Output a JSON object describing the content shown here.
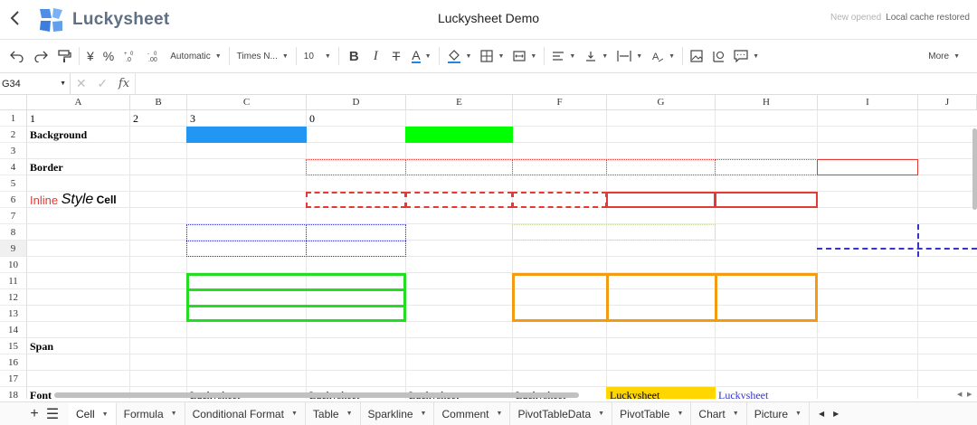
{
  "header": {
    "back_icon": "chevron-left-icon",
    "logo_text": "Luckysheet",
    "title": "Luckysheet Demo",
    "status_opened": "New opened",
    "status_restored": "Local cache restored"
  },
  "toolbar": {
    "undo_icon": "undo-icon",
    "redo_icon": "redo-icon",
    "format_painter_icon": "paint-roller-icon",
    "currency": "¥",
    "percent": "%",
    "dec_decrease": ".0←",
    "dec_increase": ".00→",
    "number_format": "Automatic",
    "font_family": "Times N...",
    "font_size": "10",
    "bold": "B",
    "italic": "I",
    "strikethrough": "T",
    "text_color": "A",
    "text_color_value": "#1e88e5",
    "fill_icon": "paint-bucket-icon",
    "more": "More"
  },
  "formula_bar": {
    "cell_ref": "G34",
    "fx": "fx"
  },
  "grid": {
    "columns": [
      "A",
      "B",
      "C",
      "D",
      "E",
      "F",
      "G",
      "H",
      "I",
      "J"
    ],
    "rows": [
      "1",
      "2",
      "3",
      "4",
      "5",
      "6",
      "7",
      "8",
      "9",
      "10",
      "11",
      "12",
      "13",
      "14",
      "15",
      "16",
      "17",
      "18"
    ],
    "selected_row": "9",
    "cells": {
      "A1": "1",
      "B1": "2",
      "C1": "3",
      "D1": "0",
      "A2": "Background",
      "A4": "Border",
      "A6_part1": "Inline ",
      "A6_part2": "Style",
      "A6_part3": " Cell",
      "A15": "Span",
      "A18": "Font",
      "C18": "Luckysheet",
      "D18": "Luckysheet",
      "E18": "Luckysheet",
      "F18": "Luckysheet",
      "G18": "Luckysheet",
      "H18": "Luckysheet"
    },
    "colors": {
      "C2_fill": "#2196f3",
      "E2_fill": "#00ff00",
      "G18_fill": "#ffd600",
      "red": "#e53935",
      "blue": "#3535c8",
      "green": "#22dd22",
      "orange": "#f39c12"
    }
  },
  "sheets": {
    "tabs": [
      "Cell",
      "Formula",
      "Conditional Format",
      "Table",
      "Sparkline",
      "Comment",
      "PivotTableData",
      "PivotTable",
      "Chart",
      "Picture"
    ],
    "active": "Cell",
    "add_icon": "plus-icon",
    "list_icon": "menu-icon"
  }
}
